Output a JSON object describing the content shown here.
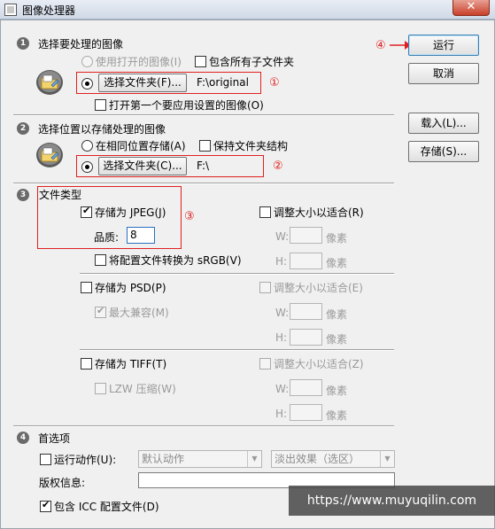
{
  "window": {
    "title": "图像处理器",
    "close": "✕"
  },
  "section1": {
    "num": "1",
    "title": "选择要处理的图像",
    "use_open_images": "使用打开的图像(I)",
    "include_subfolders": "包含所有子文件夹",
    "select_folder_btn": "选择文件夹(F)...",
    "folder_path": "F:\\original",
    "open_first_image": "打开第一个要应用设置的图像(O)"
  },
  "section2": {
    "num": "2",
    "title": "选择位置以存储处理的图像",
    "save_same_location": "在相同位置存储(A)",
    "keep_folder_structure": "保持文件夹结构",
    "select_folder_btn": "选择文件夹(C)...",
    "folder_path": "F:\\"
  },
  "section3": {
    "num": "3",
    "title": "文件类型",
    "jpeg": {
      "save_as": "存储为 JPEG(J)",
      "quality_label": "品质:",
      "quality_value": "8",
      "resize": "调整大小以适合(R)",
      "convert_srgb": "将配置文件转换为 sRGB(V)"
    },
    "psd": {
      "save_as": "存储为 PSD(P)",
      "resize": "调整大小以适合(E)",
      "max_compat": "最大兼容(M)"
    },
    "tiff": {
      "save_as": "存储为 TIFF(T)",
      "resize": "调整大小以适合(Z)",
      "lzw": "LZW 压缩(W)"
    },
    "w_label": "W:",
    "h_label": "H:",
    "pixels": "像素"
  },
  "section4": {
    "num": "4",
    "title": "首选项",
    "run_action": "运行动作(U):",
    "action_set": "默认动作",
    "action_name": "淡出效果（选区）",
    "copyright_label": "版权信息:",
    "copyright_value": "",
    "include_icc": "包含 ICC 配置文件(D)"
  },
  "buttons": {
    "run": "运行",
    "cancel": "取消",
    "load": "载入(L)...",
    "save": "存储(S)..."
  },
  "annotations": {
    "a1": "①",
    "a2": "②",
    "a3": "③",
    "a4": "④"
  },
  "watermark": "https://www.muyuqilin.com",
  "colors": {
    "annotation": "#e02020",
    "title_bar": "#dce4ee",
    "dialog_bg": "#f0f0f0"
  }
}
